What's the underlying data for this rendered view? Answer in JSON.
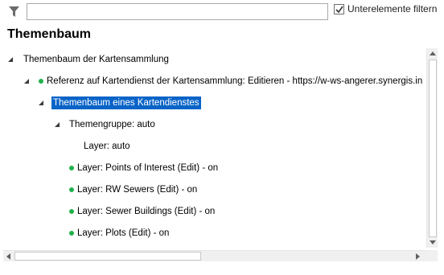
{
  "filter": {
    "input_value": "",
    "checkbox_label": "Unterelemente filtern",
    "checkbox_checked": true
  },
  "title": "Themenbaum",
  "tree": [
    {
      "label": "Themenbaum der Kartensammlung",
      "expanded": true,
      "dot": false,
      "selected": false
    },
    {
      "label": "Referenz auf Kartendienst der Kartensammlung: Editieren - https://w-ws-angerer.synergis.in",
      "expanded": true,
      "dot": true,
      "selected": false
    },
    {
      "label": "Themenbaum eines Kartendienstes",
      "expanded": true,
      "dot": false,
      "selected": true
    },
    {
      "label": "Themengruppe: auto",
      "expanded": true,
      "dot": false,
      "selected": false
    },
    {
      "label": "Layer: auto",
      "expanded": false,
      "dot": false,
      "selected": false
    },
    {
      "label": "Layer: Points of Interest (Edit) - on",
      "expanded": false,
      "dot": true,
      "selected": false
    },
    {
      "label": "Layer: RW Sewers (Edit) - on",
      "expanded": false,
      "dot": true,
      "selected": false
    },
    {
      "label": "Layer: Sewer Buildings (Edit) - on",
      "expanded": false,
      "dot": true,
      "selected": false
    },
    {
      "label": "Layer: Plots (Edit) - on",
      "expanded": false,
      "dot": true,
      "selected": false
    }
  ],
  "colors": {
    "selection": "#0a64c8",
    "status_dot": "#22b14c",
    "expander": "#3c3c3c"
  }
}
